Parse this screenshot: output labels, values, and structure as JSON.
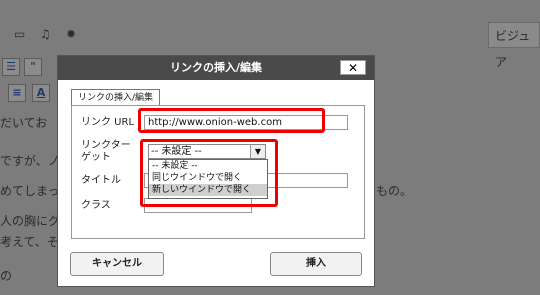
{
  "background": {
    "tab_label": "ビジュア",
    "lines": [
      "だいてお",
      "ですが、ノ",
      "めてしまっ",
      "人の胸にグ",
      "考えて、そ",
      "の"
    ],
    "right_text": "もの。",
    "buttons": [
      "\"",
      "A"
    ]
  },
  "dialog": {
    "title": "リンクの挿入/編集",
    "close_label": "✕",
    "tab_label": "リンクの挿入/編集",
    "fields": {
      "url_label": "リンク URL",
      "url_value": "http://www.onion-web.com",
      "target_label_line1": "リンクター",
      "target_label_line2": "ゲット",
      "target_value": "-- 未設定 --",
      "title_label": "タイトル",
      "class_label": "クラス"
    },
    "target_options": [
      "-- 未設定 --",
      "同じウインドウで開く",
      "新しいウインドウで開く"
    ],
    "selected_option_index": 2,
    "cancel_button": "キャンセル",
    "insert_button": "挿入"
  },
  "colors": {
    "highlight": "#ee0000"
  }
}
